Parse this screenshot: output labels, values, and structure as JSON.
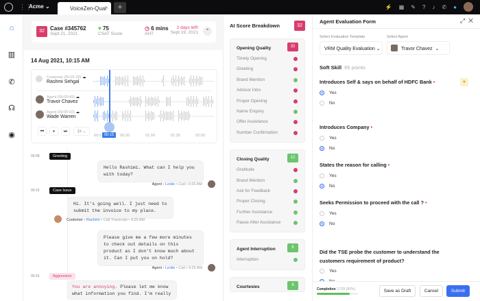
{
  "topbar": {
    "org": "Acme",
    "tab": "VoiceZen-Qual",
    "tab_close": "×",
    "new_tab": "+",
    "icons": [
      "bolt-icon",
      "calendar-icon",
      "pen-icon",
      "help-icon",
      "bell-icon",
      "phone-icon",
      "chat-icon"
    ]
  },
  "sidebar": {
    "items": [
      "home",
      "analytics",
      "calls",
      "support",
      "activity"
    ]
  },
  "case": {
    "score": "32",
    "id": "Case #345762",
    "date": "Sept 21, 2021",
    "csat": "75",
    "csat_label": "CSAT Score",
    "aht": "6 mins",
    "aht_label": "AHT",
    "due": "2 days left!",
    "due_date": "Sept 19, 2021"
  },
  "call": {
    "date": "14 Aug 2021, 10:15 AM",
    "speakers": [
      {
        "role": "Customer",
        "dur": "(00:01:20)",
        "name": "Rashmi Sehgal"
      },
      {
        "role": "Agent",
        "dur": "(00:00:43)",
        "name": "Travor Chavez"
      },
      {
        "role": "Agent",
        "dur": "(00:00:32)",
        "name": "Wade Warren"
      }
    ],
    "speed": "1x ⌄",
    "current": "00:10",
    "ticks": [
      "00:0",
      "00:30",
      "01:00",
      "01:30",
      "02:00"
    ]
  },
  "transcript": [
    {
      "ts": "00:08",
      "tag": "Greeting"
    },
    {
      "text": "Hello Rashimi. What can I help you with today?",
      "role": "Agent",
      "name": "Leslie",
      "meta": "• Call • 9:25 AM"
    },
    {
      "ts": "00:15",
      "tag": "Case Issue"
    },
    {
      "text": "Hi. It's going well. I just need to submit the invoice to my place.",
      "role": "Customer",
      "name": "Rashimi",
      "meta": "• Call Transcript • 9:25 AM"
    },
    {
      "text": "Please give me a few more minutes to check out details on this product as I don't know much about it. Can I put you on hold?",
      "role": "Agent",
      "name": "Leslie",
      "meta": "• Call • 9:25 AM"
    },
    {
      "ts": "00:15",
      "tag": "Aggression"
    },
    {
      "hl": "You are annoying.",
      "text": " Please let me know what information you find. I'm really"
    }
  ],
  "ai": {
    "title": "AI Score Breakdown",
    "score": "32",
    "sections": [
      {
        "title": "Opening Quality",
        "score": "32",
        "color": "#d83d6b",
        "items": [
          [
            "Timely Opening",
            false
          ],
          [
            "Greeting",
            false
          ],
          [
            "Brand Mention",
            true
          ],
          [
            "Advisor Intro",
            false
          ],
          [
            "Proper Opening",
            false
          ],
          [
            "Name Enquiry",
            true
          ],
          [
            "Offer Assistance",
            false
          ],
          [
            "Number Confirmation",
            false
          ]
        ]
      },
      {
        "title": "Closing Quality",
        "score": "12",
        "color": "#6cc46c",
        "items": [
          [
            "Gratitude",
            false
          ],
          [
            "Brand Mention",
            true
          ],
          [
            "Ask for Feedback",
            false
          ],
          [
            "Proper Closing",
            true
          ],
          [
            "Further Assistance",
            true
          ],
          [
            "Pause After Assistance",
            true
          ]
        ]
      },
      {
        "title": "Agent Interruption",
        "score": "6",
        "color": "#6cc46c",
        "items": [
          [
            "Interruption",
            true
          ]
        ]
      },
      {
        "title": "Courtesies",
        "score": "6",
        "color": "#6cc46c",
        "items": []
      }
    ]
  },
  "form": {
    "title": "Agent Evaluation Form",
    "template_label": "Select Evaluation Template",
    "template": "VRM Quality Evaluation",
    "agent_label": "Select Agent",
    "agent": "Travor Chavez",
    "section": "Soft Skill",
    "points": "65 points",
    "questions": [
      {
        "q": "Introduces Self & says on behalf of HDFC Bank",
        "req": true,
        "answer": "Yes"
      },
      {
        "q": "Introduces Company",
        "req": true,
        "answer": "No"
      },
      {
        "q": "States the reason for calling",
        "req": true,
        "answer": "No"
      },
      {
        "q": "Seeks Permission to proceed with the call ?",
        "req": true,
        "answer": "No"
      },
      {
        "q": "Did the TSE probe the customer to understand the customers requirement of product?",
        "req": false,
        "answer": "No"
      }
    ],
    "yes": "Yes",
    "no": "No",
    "completion_label": "Completion",
    "completion": "17/25 (80%)",
    "completion_pct": 80,
    "save": "Save as Draft",
    "cancel": "Cancel",
    "submit": "Submit"
  }
}
